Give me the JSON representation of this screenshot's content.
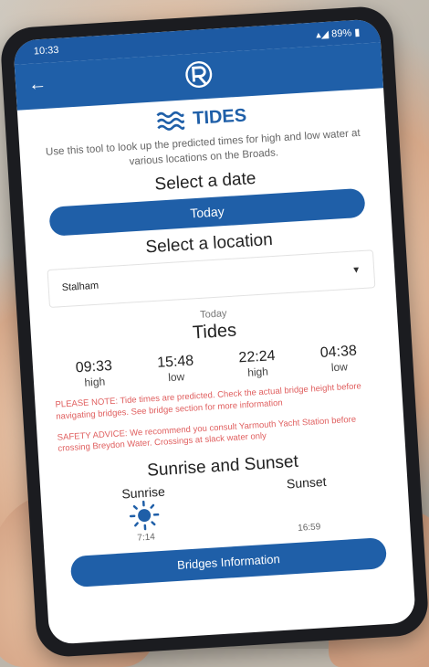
{
  "status": {
    "time": "10:33",
    "battery": "89%"
  },
  "header": {
    "back_icon": "arrow-left-icon",
    "logo_icon": "broads-logo-icon"
  },
  "page": {
    "title": "TIDES",
    "description": "Use this tool to look up the predicted times for high and low water at various locations on the Broads."
  },
  "date": {
    "heading": "Select a date",
    "button": "Today"
  },
  "location": {
    "heading": "Select a location",
    "value": "Stalham"
  },
  "tides": {
    "day": "Today",
    "heading": "Tides",
    "entries": [
      {
        "time": "09:33",
        "level": "high"
      },
      {
        "time": "15:48",
        "level": "low"
      },
      {
        "time": "22:24",
        "level": "high"
      },
      {
        "time": "04:38",
        "level": "low"
      }
    ]
  },
  "notes": {
    "please_note": "PLEASE NOTE: Tide times are predicted. Check the actual bridge height before navigating bridges. See bridge section for more information",
    "safety": "SAFETY ADVICE: We recommend you consult Yarmouth Yacht Station before crossing Breydon Water. Crossings at slack water only"
  },
  "sun": {
    "heading": "Sunrise and Sunset",
    "sunrise_label": "Sunrise",
    "sunrise_time": "7:14",
    "sunset_label": "Sunset",
    "sunset_time": "16:59"
  },
  "footer": {
    "button": "Bridges Information"
  },
  "colors": {
    "primary": "#1f5fa8",
    "warning": "#e06060",
    "sun": "#1f5fa8"
  }
}
